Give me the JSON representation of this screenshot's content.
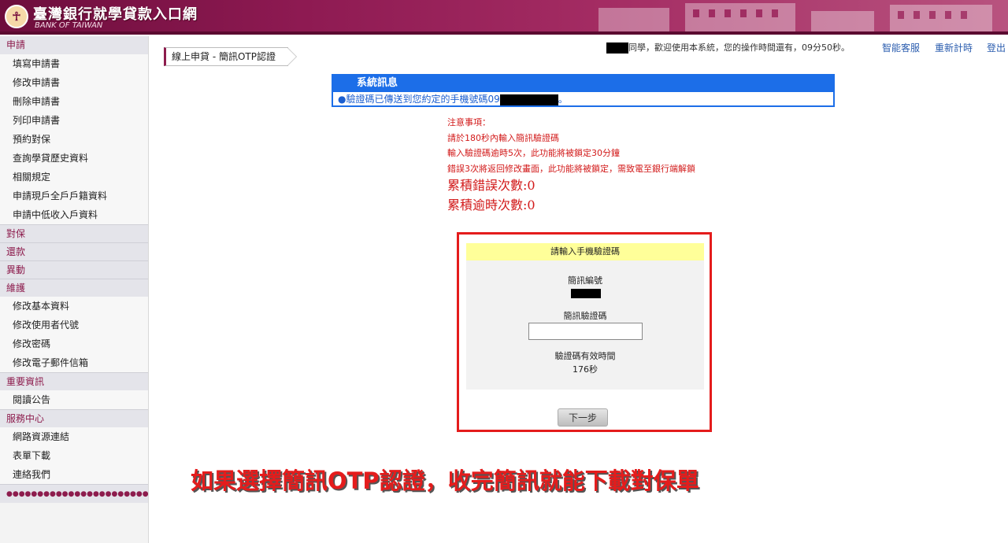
{
  "header": {
    "logo_glyph": "☥",
    "title_cn": "臺灣銀行就學貸款入口網",
    "title_en": "BANK OF TAIWAN"
  },
  "sidebar": {
    "sections": [
      {
        "label": "申請",
        "items": [
          "填寫申請書",
          "修改申請書",
          "刪除申請書",
          "列印申請書",
          "預約對保",
          "查詢學貸歷史資料",
          "相關規定",
          "申請現戶全戶戶籍資料",
          "申請中低收入戶資料"
        ]
      },
      {
        "label": "對保",
        "items": []
      },
      {
        "label": "還款",
        "items": []
      },
      {
        "label": "異動",
        "items": []
      },
      {
        "label": "維護",
        "items": [
          "修改基本資料",
          "修改使用者代號",
          "修改密碼",
          "修改電子郵件信箱"
        ]
      },
      {
        "label": "重要資訊",
        "items": [
          "閱讀公告"
        ]
      },
      {
        "label": "服務中心",
        "items": [
          "網路資源連結",
          "表單下載",
          "連絡我們"
        ]
      }
    ],
    "footer_dots": "●●●●●●●●●●●●●●●●●●●●●●●●●"
  },
  "topbar": {
    "greeting": "同學，歡迎使用本系統，您的操作時間還有，09分50秒。",
    "links": {
      "help": "智能客服",
      "reset_timer": "重新計時",
      "logout": "登出"
    }
  },
  "breadcrumb": "線上申貸 - 簡訊OTP認證",
  "system_message": {
    "title": "系統訊息",
    "text": "●驗證碼已傳送到您約定的手機號碼09",
    "suffix": "。"
  },
  "notes": {
    "heading": "注意事項：",
    "lines": [
      "請於180秒內輸入簡訊驗證碼",
      "輸入驗證碼逾時5次，此功能將被鎖定30分鐘",
      "錯誤3次將返回修改畫面，此功能將被鎖定，需致電至銀行端解鎖"
    ],
    "error_count": "累積錯誤次數:0",
    "timeout_count": "累積逾時次數:0"
  },
  "otp": {
    "header": "請輸入手機驗證碼",
    "sms_id_label": "簡訊編號",
    "code_label": "簡訊驗證碼",
    "code_value": "",
    "validity_label": "驗證碼有效時間",
    "validity_value": "176秒",
    "next_button": "下一步"
  },
  "annotation": "如果選擇簡訊OTP認證，收完簡訊就能下載對保單",
  "colors": {
    "accent": "#8d1c4d",
    "system_blue": "#1c6ee8",
    "warning_red": "#d21a1a",
    "outline_red": "#e41c1c"
  }
}
